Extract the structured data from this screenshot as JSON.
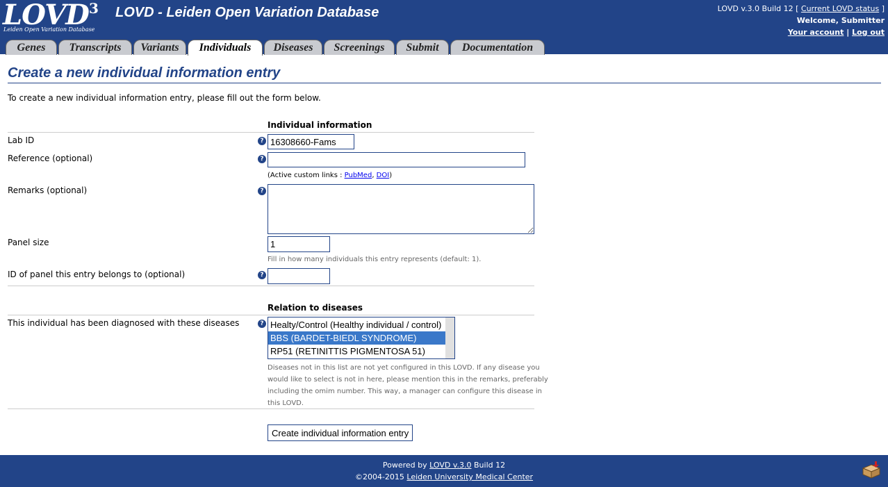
{
  "header": {
    "logo_text": "LOVD",
    "logo_sup": "3",
    "logo_subtitle": "Leiden Open Variation Database",
    "site_title": "LOVD - Leiden Open Variation Database",
    "version_text": "LOVD v.3.0 Build 12 [",
    "status_link": "Current LOVD status",
    "version_close": " ]",
    "welcome": "Welcome, Submitter",
    "account_link": "Your account",
    "divider": "|",
    "logout_link": "Log out"
  },
  "tabs": [
    {
      "label": "Genes"
    },
    {
      "label": "Transcripts"
    },
    {
      "label": "Variants"
    },
    {
      "label": "Individuals",
      "active": true
    },
    {
      "label": "Diseases"
    },
    {
      "label": "Screenings"
    },
    {
      "label": "Submit"
    },
    {
      "label": "Documentation"
    }
  ],
  "page": {
    "title": "Create a new individual information entry",
    "intro": "To create a new individual information entry, please fill out the form below."
  },
  "form": {
    "section_individual": "Individual information",
    "lab_id_label": "Lab ID",
    "lab_id_value": "16308660-Fams",
    "reference_label": "Reference (optional)",
    "reference_value": "",
    "custom_links_prefix": "(Active custom links : ",
    "custom_link_pubmed": "PubMed",
    "custom_link_sep": ", ",
    "custom_link_doi": "DOI",
    "custom_links_suffix": ")",
    "remarks_label": "Remarks (optional)",
    "remarks_value": "",
    "panel_size_label": "Panel size",
    "panel_size_value": "1",
    "panel_size_note": "Fill in how many individuals this entry represents (default: 1).",
    "panel_id_label": "ID of panel this entry belongs to (optional)",
    "panel_id_value": "",
    "section_diseases": "Relation to diseases",
    "diseases_label": "This individual has been diagnosed with these diseases",
    "disease_options": [
      {
        "label": "Healty/Control (Healthy individual / control)",
        "selected": false
      },
      {
        "label": "BBS (BARDET-BIEDL SYNDROME)",
        "selected": true
      },
      {
        "label": "RP51 (RETINITTIS PIGMENTOSA 51)",
        "selected": false
      }
    ],
    "diseases_note_lines": [
      "Diseases not in this list are not yet configured in this LOVD. If any disease you",
      "would like to select is not in here, please mention this in the remarks, preferably",
      "including the omim number. This way, a manager can configure this disease in",
      "this LOVD."
    ],
    "help_glyph": "?",
    "submit_label": "Create individual information entry"
  },
  "footer": {
    "powered_prefix": "Powered by ",
    "powered_link": "LOVD v.3.0",
    "powered_suffix": " Build 12",
    "copyright_prefix": "©2004-2015 ",
    "copyright_link": "Leiden University Medical Center"
  },
  "colors": {
    "brand": "#224488",
    "tab_inactive": "#c9cbd0",
    "selected_option": "#3a78c9"
  },
  "icons": [
    "help-icon",
    "package-icon"
  ]
}
